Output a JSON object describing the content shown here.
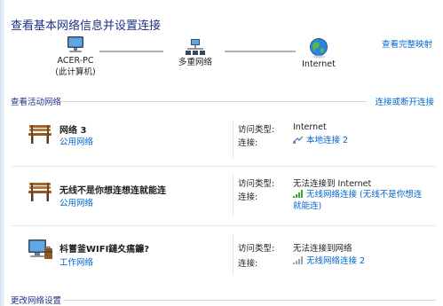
{
  "header": {
    "title": "查看基本网络信息并设置连接",
    "full_map_link": "查看完整映射"
  },
  "map": {
    "pc_name": "ACER-PC",
    "pc_sub": "(此计算机)",
    "multi_label": "多重网络",
    "internet_label": "Internet"
  },
  "active": {
    "title": "查看活动网络",
    "action_link": "连接或断开连接"
  },
  "networks": [
    {
      "name": "网络  3",
      "type": "公用网络",
      "access_label": "访问类型:",
      "access_value": "Internet",
      "conn_label": "连接:",
      "conn_value": "本地连接 2"
    },
    {
      "name": "无线不是你想连想连就能连",
      "type": "公用网络",
      "access_label": "访问类型:",
      "access_value": "无法连接到 Internet",
      "conn_label": "连接:",
      "conn_value_line1": "无线网络连接 (无线不是你想连",
      "conn_value_line2": "就能连)"
    },
    {
      "name": "枓嘗釜WIFI鏈夊瘑鐮?",
      "type": "工作网络",
      "access_label": "访问类型:",
      "access_value": "无法连接到网络",
      "conn_label": "连接:",
      "conn_value": "无线网络连接 2"
    }
  ],
  "bottom": {
    "title": "更改网络设置"
  },
  "colors": {
    "heading": "#1e3287",
    "link": "#0066cc",
    "wifi_signal": "#3aa53a"
  }
}
